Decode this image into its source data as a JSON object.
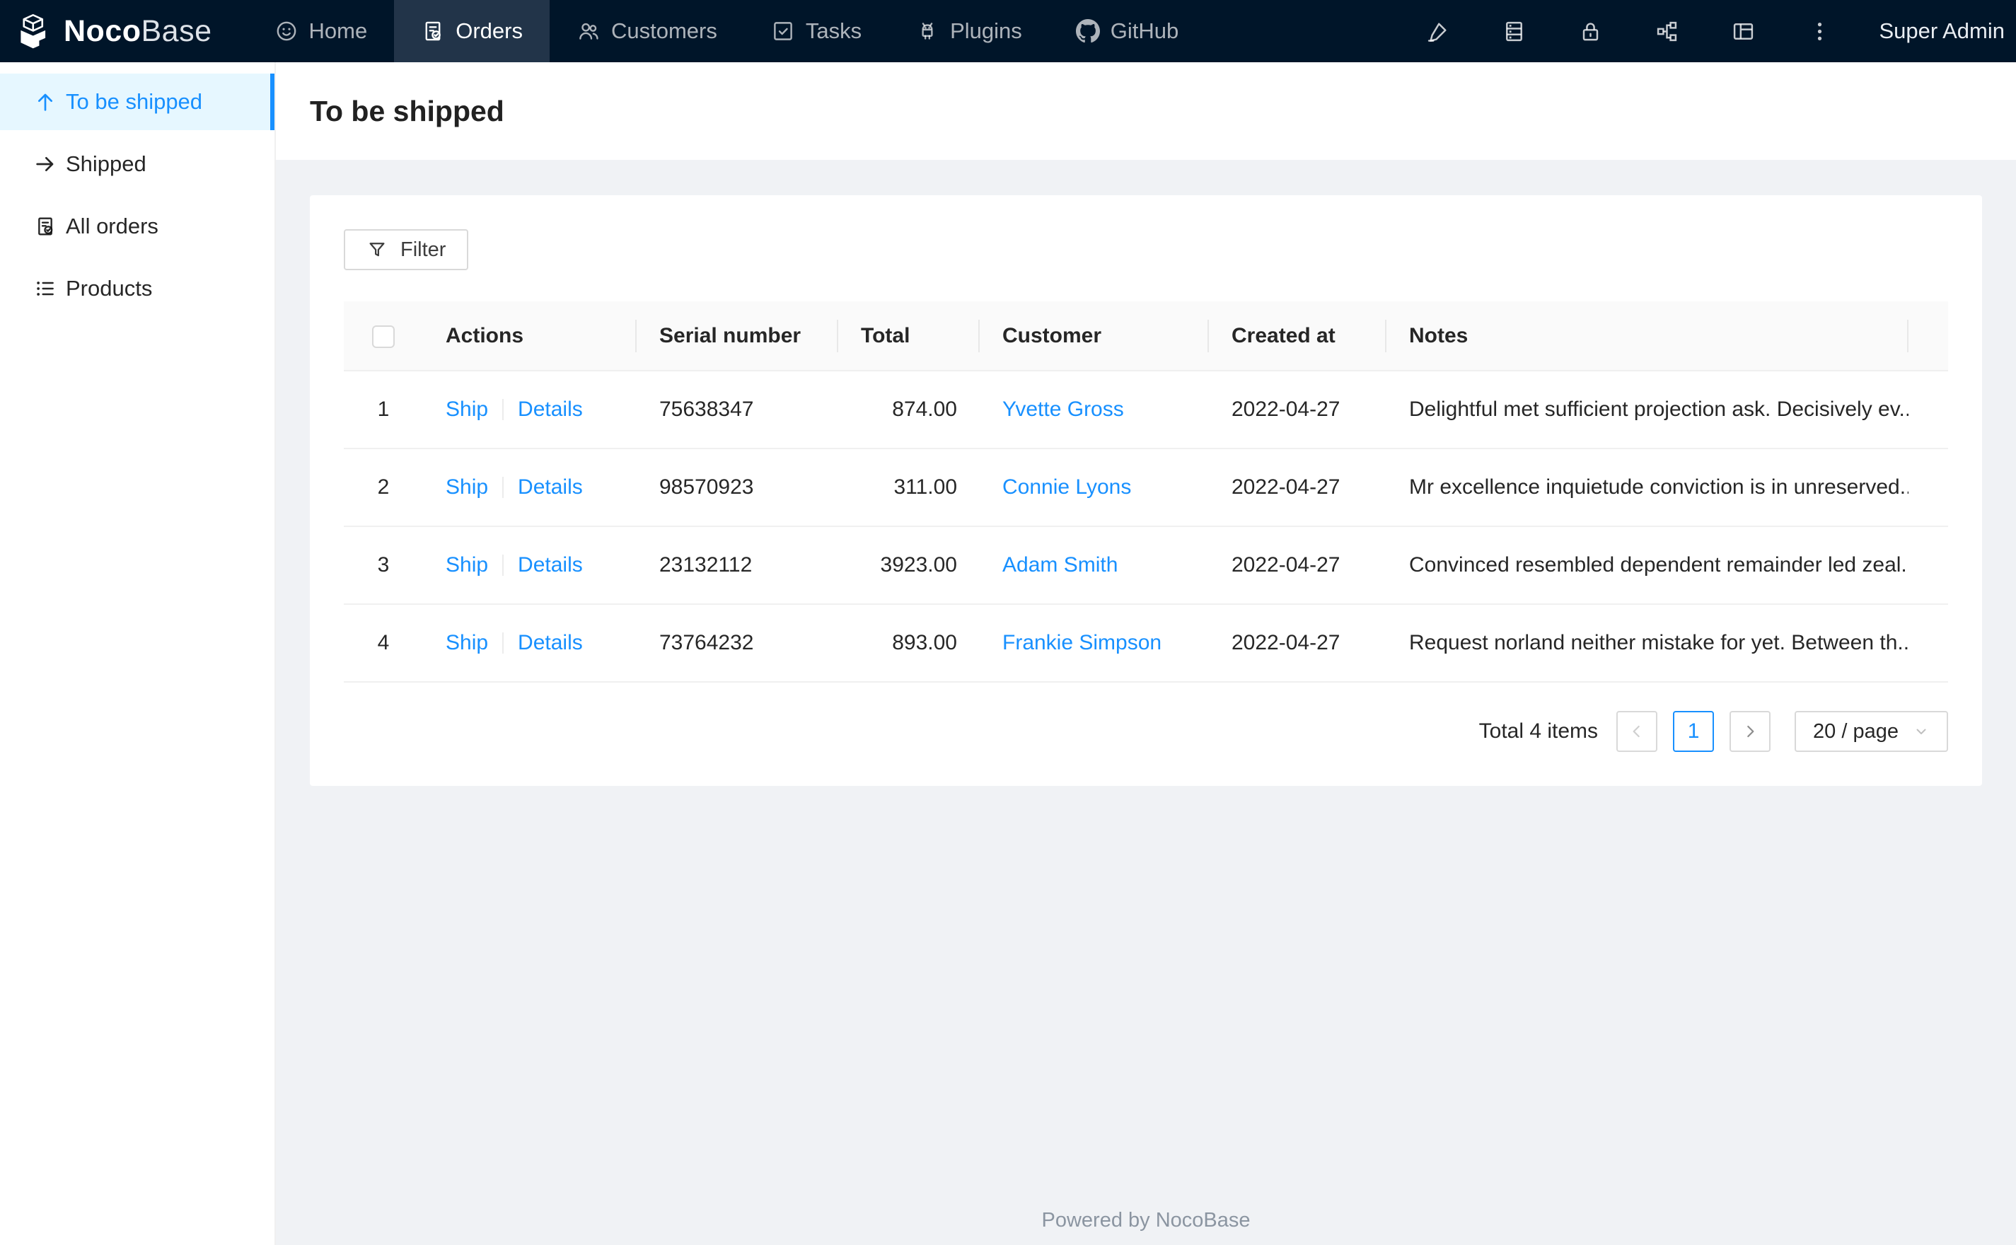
{
  "navbar": {
    "logo": {
      "noco": "Noco",
      "base": "Base"
    },
    "items": [
      {
        "label": "Home",
        "icon": "smile-icon",
        "active": false
      },
      {
        "label": "Orders",
        "icon": "file-done-icon",
        "active": true
      },
      {
        "label": "Customers",
        "icon": "team-icon",
        "active": false
      },
      {
        "label": "Tasks",
        "icon": "check-square-icon",
        "active": false
      },
      {
        "label": "Plugins",
        "icon": "android-icon",
        "active": false
      },
      {
        "label": "GitHub",
        "icon": "github-icon",
        "active": false
      }
    ],
    "right_icons": [
      "highlight-icon",
      "database-icon",
      "lock-icon",
      "partition-icon",
      "layout-icon",
      "ellipsis-icon"
    ],
    "user": "Super Admin"
  },
  "sidebar": {
    "items": [
      {
        "label": "To be shipped",
        "icon": "arrow-up-icon",
        "active": true
      },
      {
        "label": "Shipped",
        "icon": "arrow-right-icon",
        "active": false
      },
      {
        "label": "All orders",
        "icon": "file-done-icon",
        "active": false
      },
      {
        "label": "Products",
        "icon": "unordered-list-icon",
        "active": false
      }
    ]
  },
  "page": {
    "title": "To be shipped"
  },
  "toolbar": {
    "filter_label": "Filter"
  },
  "table": {
    "columns": [
      "Actions",
      "Serial number",
      "Total",
      "Customer",
      "Created at",
      "Notes"
    ],
    "rows": [
      {
        "index": "1",
        "ship": "Ship",
        "details": "Details",
        "serial": "75638347",
        "total": "874.00",
        "customer": "Yvette Gross",
        "created": "2022-04-27",
        "notes": "Delightful met sufficient projection ask. Decisively ev..."
      },
      {
        "index": "2",
        "ship": "Ship",
        "details": "Details",
        "serial": "98570923",
        "total": "311.00",
        "customer": "Connie Lyons",
        "created": "2022-04-27",
        "notes": "Mr excellence inquietude conviction is in unreserved..."
      },
      {
        "index": "3",
        "ship": "Ship",
        "details": "Details",
        "serial": "23132112",
        "total": "3923.00",
        "customer": "Adam Smith",
        "created": "2022-04-27",
        "notes": "Convinced resembled dependent remainder led zeal..."
      },
      {
        "index": "4",
        "ship": "Ship",
        "details": "Details",
        "serial": "73764232",
        "total": "893.00",
        "customer": "Frankie Simpson",
        "created": "2022-04-27",
        "notes": "Request norland neither mistake for yet. Between th..."
      }
    ]
  },
  "pagination": {
    "total_text": "Total 4 items",
    "current_page": "1",
    "page_size": "20 / page"
  },
  "footer": {
    "text": "Powered by NocoBase"
  },
  "colors": {
    "accent": "#1890ff",
    "navbar_bg": "#001529",
    "navbar_active_bg": "#223449",
    "sidebar_selected_bg": "#e6f7ff",
    "page_bg": "#f0f2f5",
    "table_header_bg": "#fafafa",
    "border": "#d9d9d9"
  }
}
